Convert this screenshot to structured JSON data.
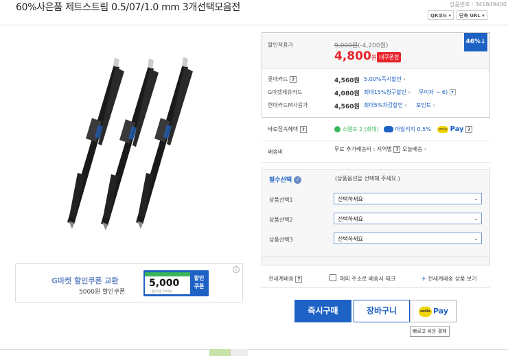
{
  "header": {
    "title": "60%사은품 제트스트림 0.5/07/1.0 mm 3개선택모음전",
    "product_no": "상품번호 : 341849400",
    "qr_button": "QR코드",
    "short_url_button": "단축 URL"
  },
  "coupon_banner": {
    "title": "G마켓 할인쿠폰 교환",
    "subtitle": "5000원 할인쿠폰",
    "amount": "5,000",
    "coupon_label": "할인\n쿠폰",
    "small_text": "할인쿠폰 5000원"
  },
  "price": {
    "label": "할인적용가",
    "original": "9,000원",
    "discount": "(-4,200원)",
    "sale": "4,800",
    "sale_unit": "원",
    "my_coupon": "내쿠폰함",
    "percent": "46%↓"
  },
  "cards": [
    {
      "name": "롯데카드",
      "price": "4,560원",
      "note": "5.00%즉시할인",
      "extra": ""
    },
    {
      "name": "G마켓제휴카드",
      "price": "4,080원",
      "note": "최대15%청구할인",
      "extra": "무이자 ~ 6)"
    },
    {
      "name": "현대카드M사용가",
      "price": "4,560원",
      "note": "최대5%차감할인",
      "extra": "포인트"
    }
  ],
  "benefits": {
    "label": "바로접속혜택",
    "stamp": "스탬프 2 (최대)",
    "mileage": "마일리지 0.5%",
    "smile_pay": "Pay"
  },
  "shipping": {
    "label": "배송비",
    "value": "무료 추가배송비 : 지역별",
    "today": "오늘배송"
  },
  "options": {
    "title": "필수선택",
    "hint": "(상품옵션을 선택해 주세요.)",
    "rows": [
      {
        "label": "상품선택1",
        "value": "선택하세요"
      },
      {
        "label": "상품선택2",
        "value": "선택하세요"
      },
      {
        "label": "상품선택3",
        "value": "선택하세요"
      }
    ]
  },
  "international": {
    "label": "전세계배송",
    "checkbox_label": "해외 주소로 배송시 체크",
    "link": "전세계배송 상품 보기"
  },
  "actions": {
    "buy": "즉시구매",
    "cart": "장바구니",
    "pay": "Pay",
    "pay_logo": "smile",
    "tooltip": "빠르고 쉬운 결제"
  },
  "colors": {
    "accent": "#1e62c5",
    "sale": "#e8232b",
    "green": "#3bb55a",
    "smile_yellow": "#f2d400"
  }
}
